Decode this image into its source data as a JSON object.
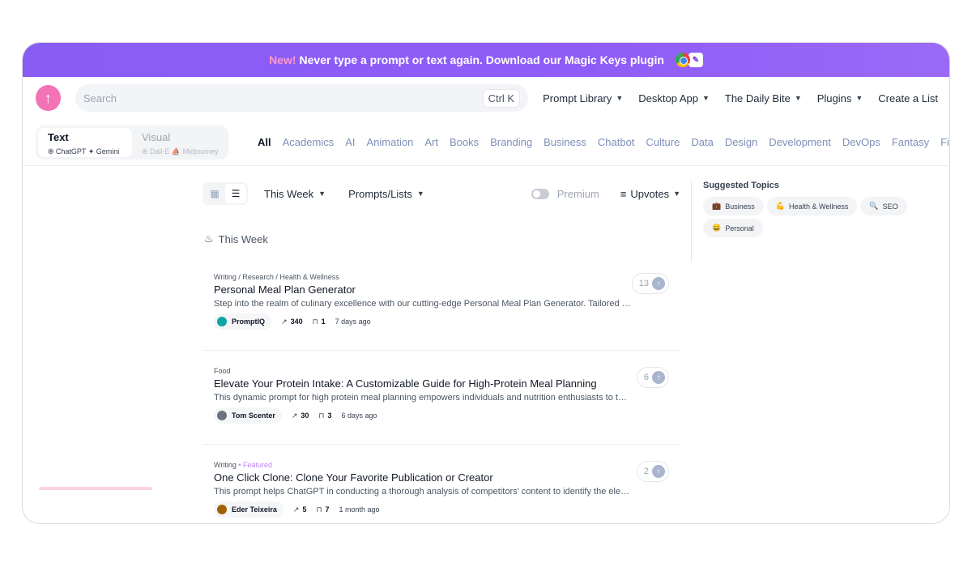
{
  "banner": {
    "new_label": "New!",
    "text": "Never type a prompt or text again. Download our Magic Keys plugin"
  },
  "header": {
    "search_placeholder": "Search",
    "shortcut": "Ctrl K",
    "nav": [
      {
        "label": "Prompt Library",
        "dropdown": true
      },
      {
        "label": "Desktop App",
        "dropdown": true
      },
      {
        "label": "The Daily Bite",
        "dropdown": true
      },
      {
        "label": "Plugins",
        "dropdown": true
      },
      {
        "label": "Create a List",
        "dropdown": false
      }
    ]
  },
  "modes": [
    {
      "title": "Text",
      "sub": "֍ ChatGPT  ✦ Gemini"
    },
    {
      "title": "Visual",
      "sub": "֍ Dall-E  ⛵ Midjourney"
    }
  ],
  "categories": [
    "All",
    "Academics",
    "AI",
    "Animation",
    "Art",
    "Books",
    "Branding",
    "Business",
    "Chatbot",
    "Culture",
    "Data",
    "Design",
    "Development",
    "DevOps",
    "Fantasy",
    "Financia"
  ],
  "toolbar": {
    "period": "This Week",
    "type": "Prompts/Lists",
    "premium": "Premium",
    "sort": "Upvotes"
  },
  "section_title": "This Week",
  "cards": [
    {
      "crumb": "Writing / Research / Health & Wellness",
      "featured": "",
      "title": "Personal Meal Plan Generator",
      "desc": "Step into the realm of culinary excellence with our cutting-edge Personal Meal Plan Generator. Tailored to y...",
      "author": "PromptIQ",
      "views": "340",
      "saves": "1",
      "time": "7 days ago",
      "votes": "13"
    },
    {
      "crumb": "Food",
      "featured": "",
      "title": "Elevate Your Protein Intake: A Customizable Guide for High-Protein Meal Planning",
      "desc": "This dynamic prompt for high protein meal planning empowers individuals and nutrition enthusiasts to tailor...",
      "author": "Tom Scenter",
      "views": "30",
      "saves": "3",
      "time": "6 days ago",
      "votes": "6"
    },
    {
      "crumb": "Writing",
      "featured": "Featured",
      "title": "One Click Clone: Clone Your Favorite Publication or Creator",
      "desc": "This prompt helps ChatGPT in conducting a thorough analysis of competitors' content to identify the elemen...",
      "author": "Eder Teixeira",
      "views": "5",
      "saves": "7",
      "time": "1 month ago",
      "votes": "2"
    }
  ],
  "suggested": {
    "title": "Suggested Topics",
    "topics": [
      {
        "emoji": "💼",
        "label": "Business"
      },
      {
        "emoji": "💪",
        "label": "Health & Wellness"
      },
      {
        "emoji": "🔍",
        "label": "SEO"
      },
      {
        "emoji": "😀",
        "label": "Personal"
      }
    ]
  }
}
